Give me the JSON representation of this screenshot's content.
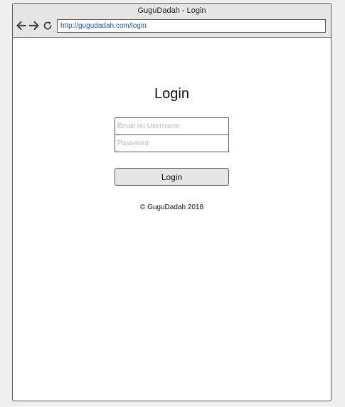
{
  "window": {
    "title": "GuguDadah - Login"
  },
  "browser": {
    "url": "http://gugudadah.com/login",
    "back_icon": "arrow-left-icon",
    "forward_icon": "arrow-right-icon",
    "reload_icon": "reload-icon"
  },
  "login": {
    "heading": "Login",
    "email_placeholder": "Email ou Username",
    "password_placeholder": "Password",
    "button_label": "Login"
  },
  "footer": {
    "copyright": "© GuguDadah 2018"
  },
  "colors": {
    "url_text": "#1e5ba9",
    "chrome_bg": "#e6e6e6",
    "border": "#5a5a5a"
  }
}
